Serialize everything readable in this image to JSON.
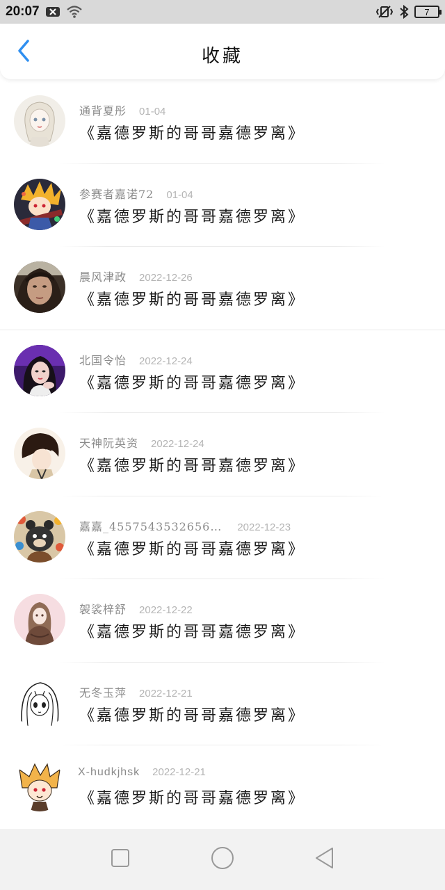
{
  "status_bar": {
    "time": "20:07",
    "battery": "7",
    "icons": [
      "notification-x-icon",
      "wifi-icon",
      "vibrate-icon",
      "bluetooth-icon",
      "battery-icon"
    ]
  },
  "header": {
    "title": "收藏",
    "back_icon": "chevron-left-icon",
    "accent_color": "#2f8ff0"
  },
  "items": [
    {
      "username": "通背夏彤",
      "date": "01-04",
      "content": "《嘉德罗斯的哥哥嘉德罗离》",
      "avatar": "avatar-girl-sketch"
    },
    {
      "username": "参赛者嘉诺72",
      "date": "01-04",
      "content": "《嘉德罗斯的哥哥嘉德罗离》",
      "avatar": "avatar-anime-boy"
    },
    {
      "username": "晨风津政",
      "date": "2022-12-26",
      "content": "《嘉德罗斯的哥哥嘉德罗离》",
      "avatar": "avatar-girl-photo"
    },
    {
      "username": "北国令怡",
      "date": "2022-12-24",
      "content": "《嘉德罗斯的哥哥嘉德罗离》",
      "avatar": "avatar-girl-purple"
    },
    {
      "username": "天神阮英资",
      "date": "2022-12-24",
      "content": "《嘉德罗斯的哥哥嘉德罗离》",
      "avatar": "avatar-dark-hair"
    },
    {
      "username": "嘉嘉_4557543532656…",
      "date": "2022-12-23",
      "content": "《嘉德罗斯的哥哥嘉德罗离》",
      "avatar": "avatar-bear"
    },
    {
      "username": "袈裟梓舒",
      "date": "2022-12-22",
      "content": "《嘉德罗斯的哥哥嘉德罗离》",
      "avatar": "avatar-girl-pink"
    },
    {
      "username": "无冬玉萍",
      "date": "2022-12-21",
      "content": "《嘉德罗斯的哥哥嘉德罗离》",
      "avatar": "avatar-lineart-girl"
    },
    {
      "username": "X-hudkjhsk",
      "date": "2022-12-21",
      "content": "《嘉德罗斯的哥哥嘉德罗离》",
      "avatar": "avatar-chibi"
    }
  ],
  "nav": {
    "icons": [
      "square-recents-icon",
      "circle-home-icon",
      "triangle-back-icon"
    ]
  }
}
